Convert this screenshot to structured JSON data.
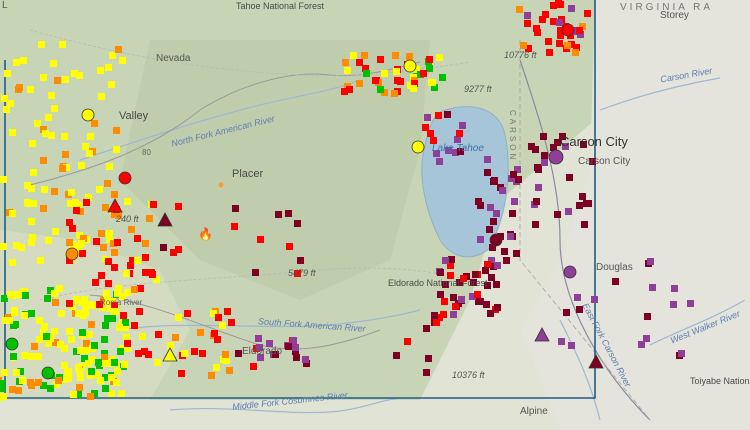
{
  "map": {
    "labels": {
      "tahoe_nf": "Tahoe National Forest",
      "virginia": "VIRGINIA RA",
      "storey": "Storey",
      "nevada": "Nevada",
      "valley": "Valley",
      "placer": "Placer",
      "lake_tahoe": "Lake Tahoe",
      "carson_city": "Carson City",
      "carson_city_county": "Carson City",
      "carson_range": "CARSON",
      "douglas": "Douglas",
      "eldorado_nf": "Eldorado National Forest",
      "eldorado": "Eldorado",
      "toiyabe_nf": "Toiyabe National Forest",
      "alpine": "Alpine",
      "peak_10776": "10776 ft",
      "peak_9277": "9277 ft",
      "peak_5479": "5479 ft",
      "peak_10376": "10376 ft",
      "elev_240": "240 ft",
      "north_fork_american_river": "North Fork American River",
      "south_fork_american_river": "South Fork American River",
      "carson_river": "Carson River",
      "west_walker_river": "West Walker River",
      "middle_fork_cosumnes": "Middle Fork Cosumnes River",
      "east_fork_carson": "East Fork Carson River",
      "roma_river": "Roma River",
      "hwy_80": "80",
      "lake_partial": "L"
    },
    "colors": {
      "good": "#00c000",
      "moderate": "#ffff00",
      "usg": "#ff8c00",
      "unhealthy": "#ff0000",
      "very_unhealthy": "#8f3f97",
      "hazardous": "#7e0023",
      "lake": "#a7c5d8",
      "boundary": "#1f5d8a"
    },
    "icons": [
      "fire-icon",
      "wildfire-hotspot-icon",
      "monitor-circle-icon",
      "monitor-triangle-icon",
      "sensor-square-icon"
    ]
  }
}
